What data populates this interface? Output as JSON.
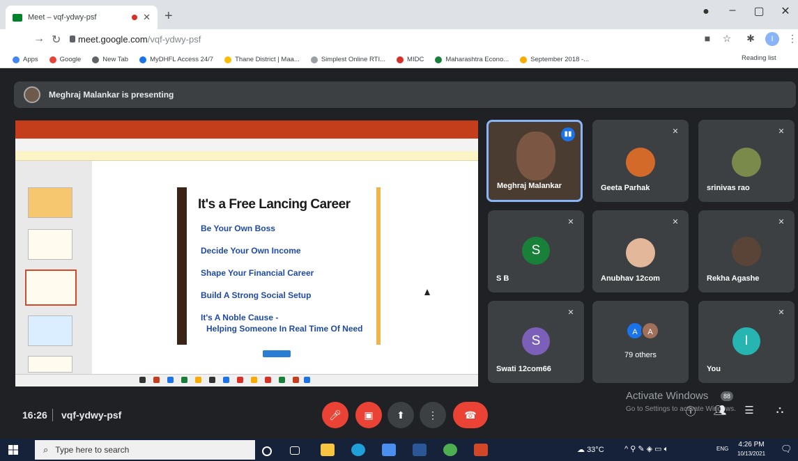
{
  "browser": {
    "tab_title": "Meet – vqf-ydwy-psf",
    "url_host": "meet.google.com",
    "url_path": "/vqf-ydwy-psf",
    "profile_initial": "I",
    "bookmarks": [
      {
        "label": "Apps",
        "color": "#4285f4"
      },
      {
        "label": "Google",
        "color": "#ea4335"
      },
      {
        "label": "New Tab",
        "color": "#5f6368"
      },
      {
        "label": "MyDHFL Access 24/7",
        "color": "#1a73e8"
      },
      {
        "label": "Thane District | Maa...",
        "color": "#fbbc04"
      },
      {
        "label": "Simplest Online RTI...",
        "color": "#9aa0a6"
      },
      {
        "label": "MIDC",
        "color": "#d93025"
      },
      {
        "label": "Maharashtra Econo...",
        "color": "#188038"
      },
      {
        "label": "September 2018 -...",
        "color": "#f9ab00"
      }
    ],
    "reading_list": "Reading list"
  },
  "meet": {
    "presenting_banner": "Meghraj Malankar is presenting",
    "slide": {
      "title": "It's a Free Lancing Career",
      "bullets": [
        "Be Your Own Boss",
        "Decide Your Own Income",
        "Shape Your Financial Career",
        "Build A Strong Social Setup",
        "It's A Noble Cause -",
        "Helping Someone In Real Time Of Need"
      ]
    },
    "participants": [
      {
        "name": "Meghraj Malankar",
        "type": "video"
      },
      {
        "name": "Geeta Parhak",
        "type": "photo"
      },
      {
        "name": "srinivas rao",
        "type": "photo"
      },
      {
        "name": "S B",
        "type": "letter",
        "letter": "S",
        "color": "#188038"
      },
      {
        "name": "Anubhav 12com",
        "type": "photo"
      },
      {
        "name": "Rekha Agashe",
        "type": "photo"
      },
      {
        "name": "Swati 12com66",
        "type": "letter",
        "letter": "S",
        "color": "#7b5fb8"
      },
      {
        "name": "79 others",
        "type": "group",
        "letters": [
          "A",
          "A"
        ]
      },
      {
        "name": "You",
        "type": "letter",
        "letter": "I",
        "color": "#26b5b0"
      }
    ],
    "time": "16:26",
    "meeting_code": "vqf-ydwy-psf",
    "people_count": "88",
    "watermark_title": "Activate Windows",
    "watermark_sub": "Go to Settings to activate Windows."
  },
  "taskbar": {
    "search_placeholder": "Type here to search",
    "weather": "33°C",
    "lang": "ENG",
    "time": "4:26 PM",
    "date": "10/13/2021"
  },
  "colors": {
    "end_call": "#ea4335",
    "accent": "#8ab4f8"
  }
}
